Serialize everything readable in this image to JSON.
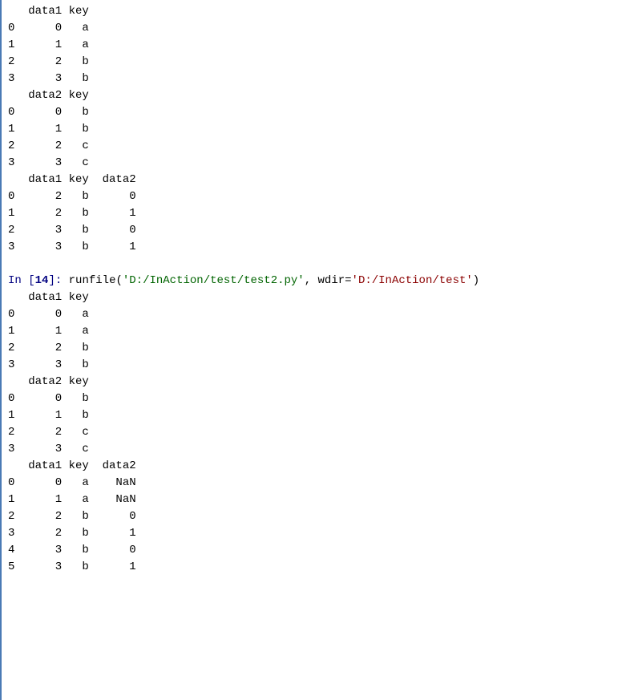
{
  "prompt": {
    "in_label": "In ",
    "number": "14",
    "func": "runfile",
    "arg1": "'D:/InAction/test/test2.py'",
    "kwarg": "wdir",
    "arg2": "'D:/InAction/test'"
  },
  "blocks": [
    {
      "df1": {
        "header": "   data1 key",
        "rows": [
          "0      0   a",
          "1      1   a",
          "2      2   b",
          "3      3   b"
        ]
      },
      "df2": {
        "header": "   data2 key",
        "rows": [
          "0      0   b",
          "1      1   b",
          "2      2   c",
          "3      3   c"
        ]
      },
      "merged": {
        "header": "   data1 key  data2",
        "rows": [
          "0      2   b      0",
          "1      2   b      1",
          "2      3   b      0",
          "3      3   b      1"
        ]
      }
    },
    {
      "df1": {
        "header": "   data1 key",
        "rows": [
          "0      0   a",
          "1      1   a",
          "2      2   b",
          "3      3   b"
        ]
      },
      "df2": {
        "header": "   data2 key",
        "rows": [
          "0      0   b",
          "1      1   b",
          "2      2   c",
          "3      3   c"
        ]
      },
      "merged": {
        "header": "   data1 key  data2",
        "rows": [
          "0      0   a    NaN",
          "1      1   a    NaN",
          "2      2   b      0",
          "3      2   b      1",
          "4      3   b      0",
          "5      3   b      1"
        ]
      }
    }
  ]
}
